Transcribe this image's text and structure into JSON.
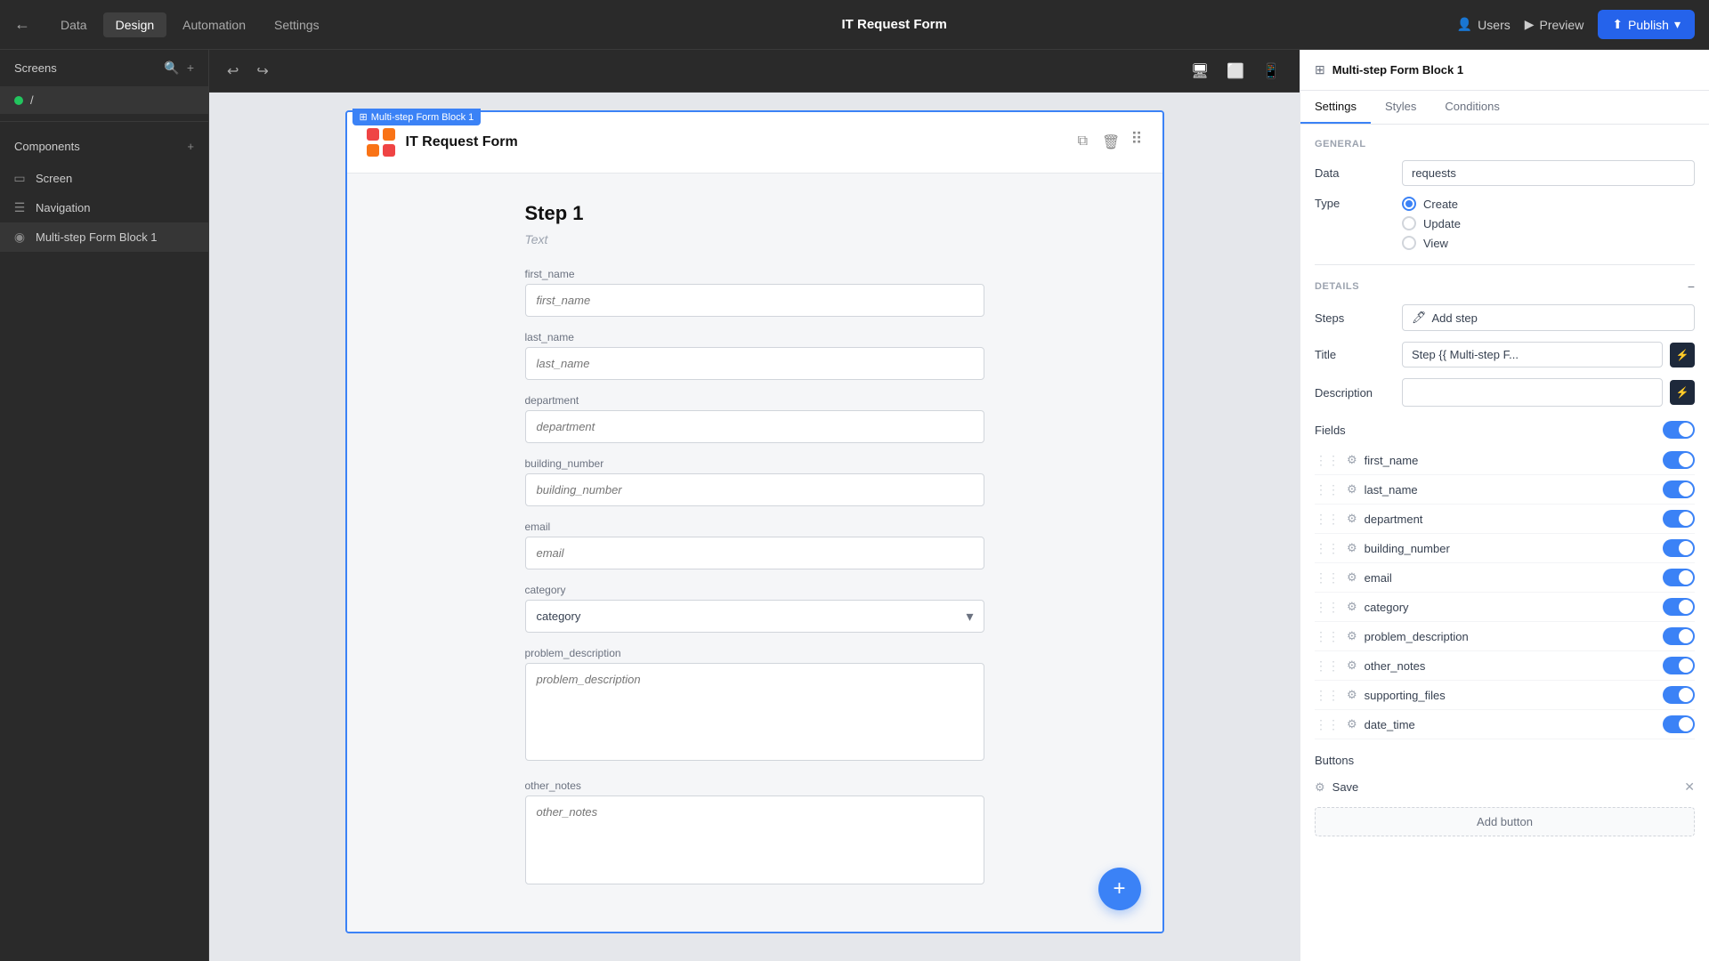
{
  "topbar": {
    "back_icon": "←",
    "title": "IT Request Form",
    "tabs": [
      {
        "id": "data",
        "label": "Data"
      },
      {
        "id": "design",
        "label": "Design",
        "active": true
      },
      {
        "id": "automation",
        "label": "Automation"
      },
      {
        "id": "settings",
        "label": "Settings"
      }
    ],
    "users_label": "Users",
    "preview_label": "Preview",
    "publish_label": "Publish"
  },
  "left_sidebar": {
    "screens_title": "Screens",
    "screen_item": "/",
    "components_title": "Components",
    "components": [
      {
        "id": "screen",
        "label": "Screen",
        "icon": "▭"
      },
      {
        "id": "navigation",
        "label": "Navigation",
        "icon": "☰"
      },
      {
        "id": "multistep",
        "label": "Multi-step Form Block 1",
        "icon": "◉",
        "active": true
      }
    ]
  },
  "canvas": {
    "form_title": "IT Request Form",
    "form_label_tag": "Multi-step Form Block 1",
    "step_title": "Step 1",
    "step_text": "Text",
    "fields": [
      {
        "id": "first_name",
        "label": "first_name",
        "placeholder": "first_name",
        "type": "text"
      },
      {
        "id": "last_name",
        "label": "last_name",
        "placeholder": "last_name",
        "type": "text"
      },
      {
        "id": "department",
        "label": "department",
        "placeholder": "department",
        "type": "text"
      },
      {
        "id": "building_number",
        "label": "building_number",
        "placeholder": "building_number",
        "type": "text"
      },
      {
        "id": "email",
        "label": "email",
        "placeholder": "email",
        "type": "text"
      },
      {
        "id": "category",
        "label": "category",
        "placeholder": "category",
        "type": "select"
      },
      {
        "id": "problem_description",
        "label": "problem_description",
        "placeholder": "problem_description",
        "type": "textarea"
      },
      {
        "id": "other_notes",
        "label": "other_notes",
        "placeholder": "other_notes",
        "type": "textarea"
      }
    ]
  },
  "right_sidebar": {
    "title": "Multi-step Form Block 1",
    "tabs": [
      {
        "id": "settings",
        "label": "Settings",
        "active": true
      },
      {
        "id": "styles",
        "label": "Styles"
      },
      {
        "id": "conditions",
        "label": "Conditions"
      }
    ],
    "general": {
      "section_label": "GENERAL",
      "data_label": "Data",
      "data_value": "requests",
      "type_label": "Type",
      "type_options": [
        {
          "id": "create",
          "label": "Create",
          "selected": true
        },
        {
          "id": "update",
          "label": "Update"
        },
        {
          "id": "view",
          "label": "View"
        }
      ]
    },
    "details": {
      "section_label": "DETAILS",
      "steps_label": "Steps",
      "add_step_label": "Add step",
      "title_label": "Title",
      "title_value": "Step {{ Multi-step F...",
      "description_label": "Description",
      "description_value": "",
      "fields_label": "Fields",
      "field_items": [
        {
          "id": "first_name",
          "name": "first_name"
        },
        {
          "id": "last_name",
          "name": "last_name"
        },
        {
          "id": "department",
          "name": "department"
        },
        {
          "id": "building_number",
          "name": "building_number"
        },
        {
          "id": "email",
          "name": "email"
        },
        {
          "id": "category",
          "name": "category"
        },
        {
          "id": "problem_description",
          "name": "problem_description"
        },
        {
          "id": "other_notes",
          "name": "other_notes"
        },
        {
          "id": "supporting_files",
          "name": "supporting_files"
        },
        {
          "id": "date_time",
          "name": "date_time"
        }
      ],
      "buttons_label": "Buttons",
      "button_items": [
        {
          "id": "save",
          "name": "Save"
        }
      ],
      "add_button_label": "Add button"
    }
  }
}
